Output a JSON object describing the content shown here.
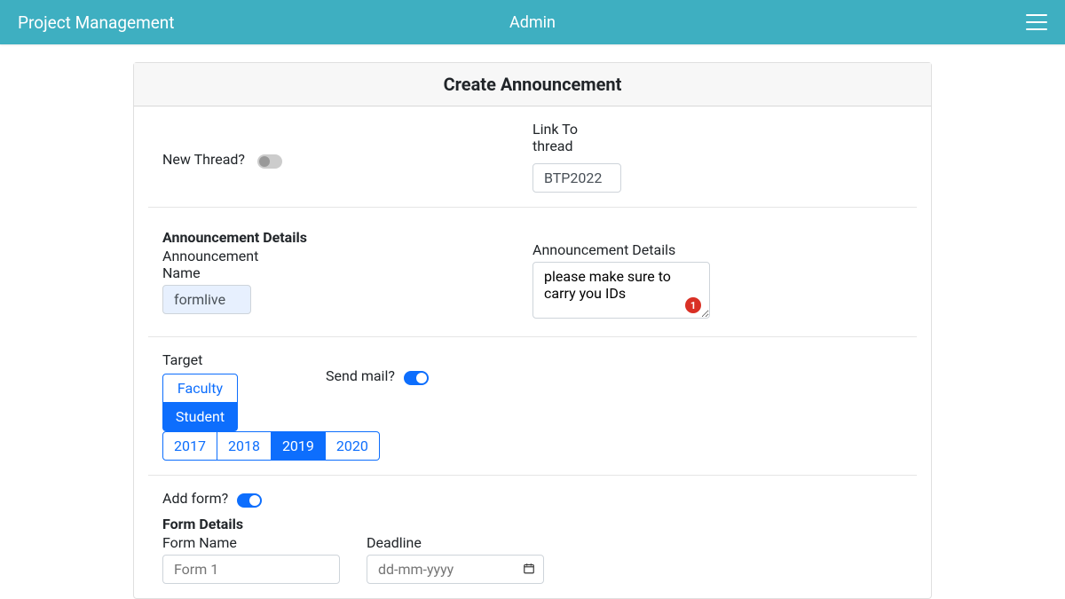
{
  "navbar": {
    "brand": "Project Management",
    "center": "Admin"
  },
  "card": {
    "title": "Create Announcement"
  },
  "thread": {
    "new_thread_label": "New Thread?",
    "link_to_label": "Link To thread",
    "link_to_value": "BTP2022"
  },
  "announcement": {
    "section_heading": "Announcement Details",
    "name_label": "Announcement Name",
    "name_value": "formlive",
    "details_label": "Announcement Details",
    "details_value": "please make sure to carry you IDs",
    "badge": "1"
  },
  "target": {
    "target_label": "Target",
    "send_mail_label": "Send mail?",
    "role_options": [
      "Faculty",
      "Student"
    ],
    "role_selected": "Student",
    "year_options": [
      "2017",
      "2018",
      "2019",
      "2020"
    ],
    "year_selected": "2019"
  },
  "form": {
    "add_form_label": "Add form?",
    "form_details_heading": "Form Details",
    "form_name_label": "Form Name",
    "form_name_placeholder": "Form 1",
    "deadline_label": "Deadline",
    "deadline_placeholder": "dd-mm-yyyy"
  }
}
